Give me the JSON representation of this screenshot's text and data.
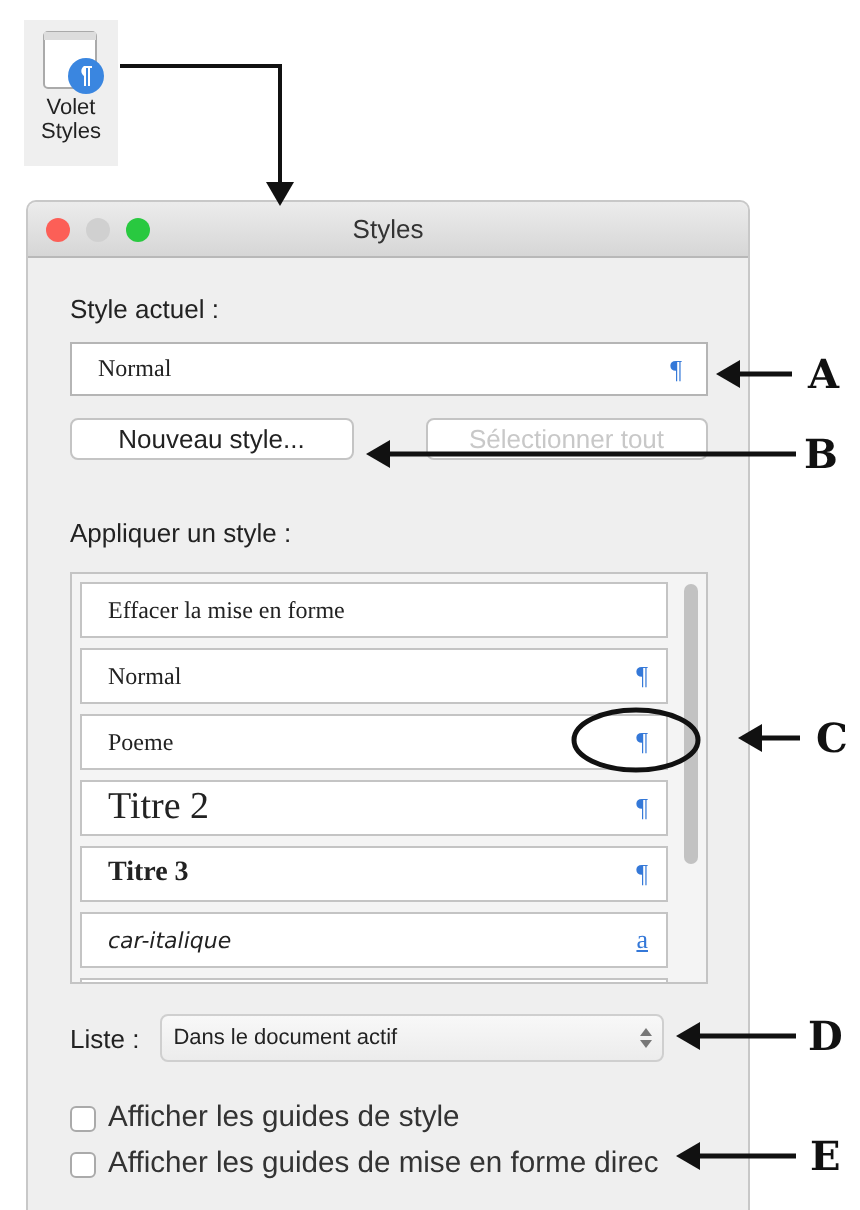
{
  "toolbar_icon": {
    "label": "Volet Styles"
  },
  "window": {
    "title": "Styles"
  },
  "current_style": {
    "label": "Style actuel :",
    "value": "Normal",
    "marker": "¶"
  },
  "buttons": [
    {
      "label": "Nouveau style...",
      "disabled": false
    },
    {
      "label": "Sélectionner tout",
      "disabled": true
    }
  ],
  "apply_style": {
    "label": "Appliquer un style :",
    "items": [
      {
        "name": "Effacer la mise en forme",
        "kind": "plain"
      },
      {
        "name": "Normal",
        "kind": "plain",
        "marker": "¶"
      },
      {
        "name": "Poeme",
        "kind": "plain",
        "marker": "¶"
      },
      {
        "name": "Titre 2",
        "kind": "heading2",
        "marker": "¶"
      },
      {
        "name": "Titre 3",
        "kind": "heading3",
        "marker": "¶"
      },
      {
        "name": "car-italique",
        "kind": "italic",
        "marker": "a"
      }
    ]
  },
  "list_filter": {
    "label": "Liste :",
    "value": "Dans le document actif"
  },
  "checkboxes": [
    {
      "label": "Afficher les guides de style",
      "checked": false
    },
    {
      "label": "Afficher les guides de mise en forme direc",
      "checked": false
    }
  ],
  "callouts": [
    {
      "letter": "A"
    },
    {
      "letter": "B"
    },
    {
      "letter": "C"
    },
    {
      "letter": "D"
    },
    {
      "letter": "E"
    }
  ]
}
